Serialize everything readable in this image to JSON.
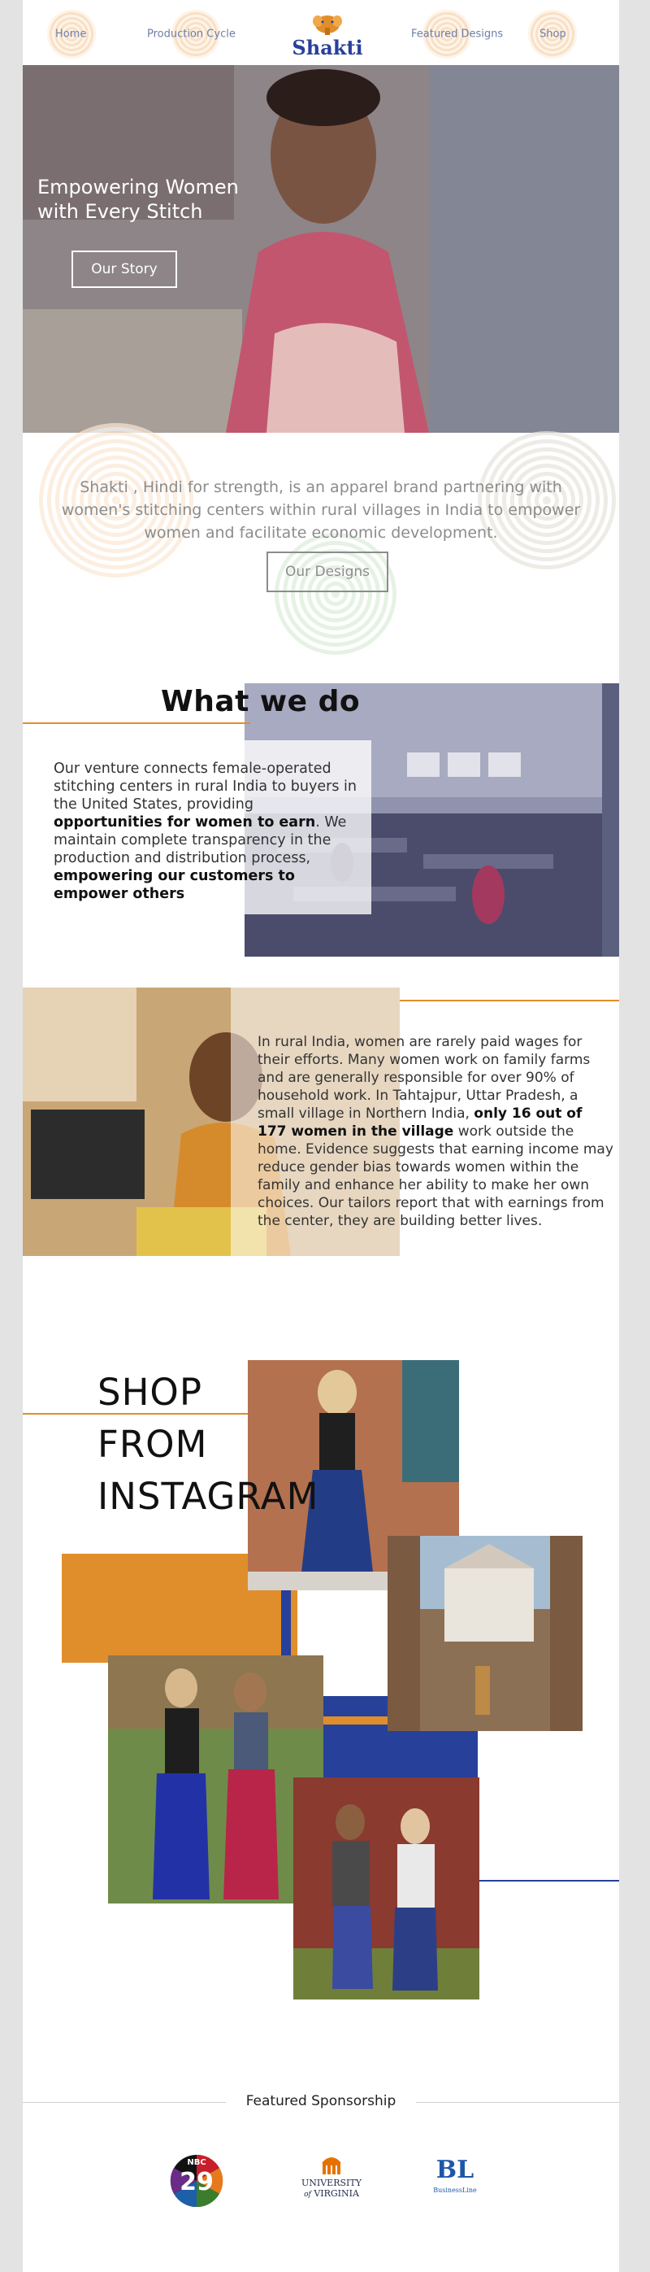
{
  "nav": {
    "items": [
      {
        "label": "Home"
      },
      {
        "label": "Production Cycle"
      },
      {
        "label": "Featured Designs"
      },
      {
        "label": "Shop"
      }
    ],
    "logo_text": "Shakti"
  },
  "hero": {
    "title": "Empowering Women with Every Stitch",
    "button": "Our Story"
  },
  "intro": {
    "text": "Shakti , Hindi for strength, is an apparel brand partnering with women's stitching centers within rural villages in India to empower women and facilitate economic development.",
    "button": "Our Designs"
  },
  "what_we_do": {
    "title": "What we do",
    "text_1": "Our venture connects female-operated stitching centers in rural India to buyers in the United States, providing ",
    "bold_1": "opportunities for women to earn",
    "text_2": ". We maintain complete transparency in the production and distribution process, ",
    "bold_2": "empowering our customers to empower others"
  },
  "rural": {
    "text_1": "In rural India, women are rarely paid wages for their efforts. Many women work on family farms and are generally responsible for over 90% of household work. In Tahtajpur, Uttar Pradesh, a small village in Northern India, ",
    "bold": "only 16 out of 177 women in the village",
    "text_2": " work outside the home. Evidence suggests that earning income may reduce gender bias towards women within the family and enhance her ability to make her own choices. Our tailors report that with earnings from the center, they are building better lives."
  },
  "instagram": {
    "title_lines": [
      "SHOP",
      "FROM",
      "INSTAGRAM"
    ]
  },
  "sponsorship": {
    "title": "Featured Sponsorship",
    "logos": [
      {
        "name": "NBC 29",
        "line1": "NBC",
        "line2": "29"
      },
      {
        "name": "University of Virginia",
        "line1": "UNIVERSITY",
        "line2": "VIRGINIA",
        "of": "of"
      },
      {
        "name": "BusinessLine",
        "line1": "BL",
        "line2": "BusinessLine"
      }
    ]
  },
  "colors": {
    "accent_orange": "#e08e2b",
    "accent_blue": "#27409a",
    "nav_text": "#6f7ea8"
  }
}
